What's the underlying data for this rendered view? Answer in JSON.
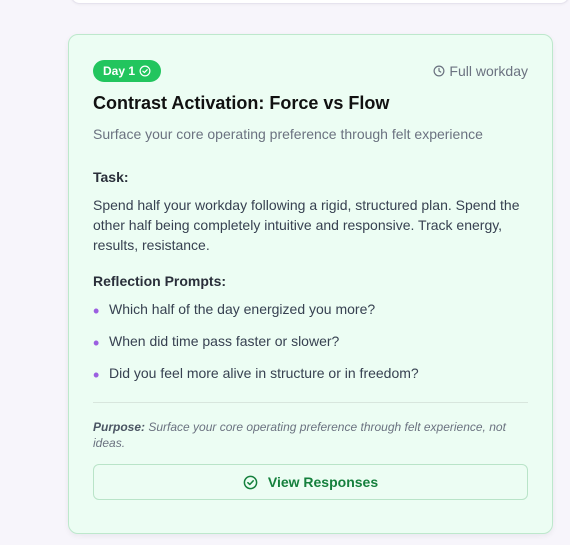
{
  "card": {
    "day_badge": "Day 1",
    "duration": "Full workday",
    "title": "Contrast Activation: Force vs Flow",
    "subtitle": "Surface your core operating preference through felt experience",
    "task_label": "Task:",
    "task_text": "Spend half your workday following a rigid, structured plan. Spend the other half being completely intuitive and responsive. Track energy, results, resistance.",
    "prompts_label": "Reflection Prompts:",
    "prompts": [
      "Which half of the day energized you more?",
      "When did time pass faster or slower?",
      "Did you feel more alive in structure or in freedom?"
    ],
    "purpose_label": "Purpose:",
    "purpose_text": "Surface your core operating preference through felt experience, not ideas.",
    "view_button_label": "View Responses"
  },
  "icons": {
    "day_badge": "check-circle-icon",
    "duration": "clock-icon",
    "view_button": "check-circle-icon",
    "bullet": "bullet-dot-icon"
  },
  "colors": {
    "badge_bg": "#22c55e",
    "card_bg": "#ecfdf3",
    "card_border": "#bde8cc",
    "accent_green": "#15803d",
    "bullet_purple": "#9b5fe0"
  }
}
